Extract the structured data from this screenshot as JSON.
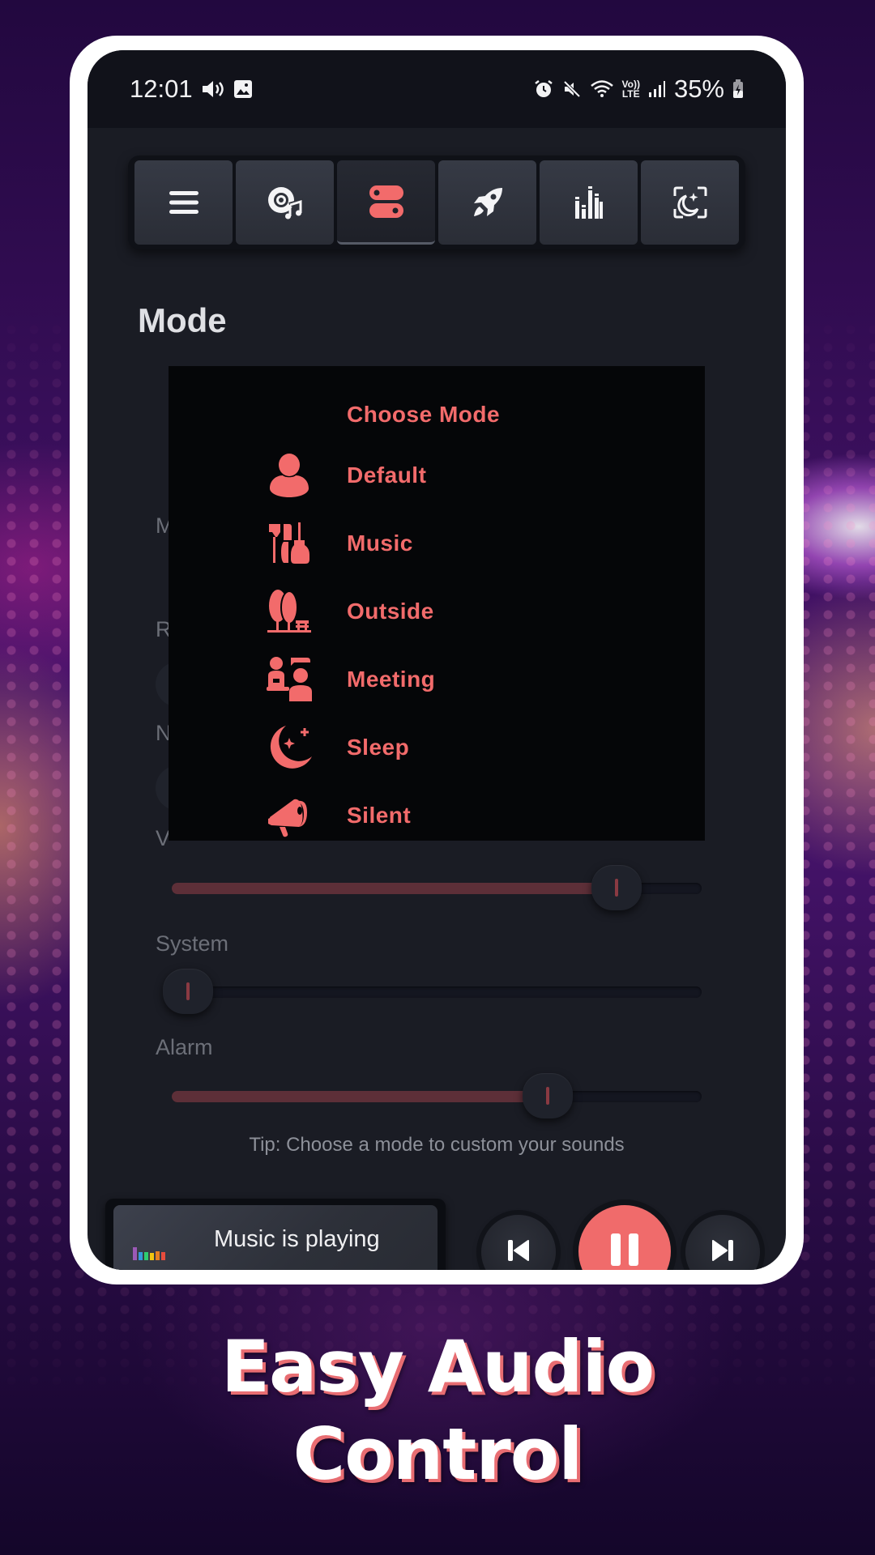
{
  "status_bar": {
    "time": "12:01",
    "left_icons": [
      "volume-icon",
      "image-icon"
    ],
    "right_icons": [
      "alarm-icon",
      "mute-icon",
      "wifi-icon",
      "volte-icon",
      "signal-icon"
    ],
    "volte_top": "Vo))",
    "volte_bottom": "LTE",
    "battery": "35%"
  },
  "toolbar": {
    "tabs": [
      {
        "name": "menu",
        "icon": "menu-icon",
        "active": false
      },
      {
        "name": "music-disc",
        "icon": "disc-music-icon",
        "active": false
      },
      {
        "name": "mode",
        "icon": "toggle-icon",
        "active": true
      },
      {
        "name": "boost",
        "icon": "rocket-icon",
        "active": false
      },
      {
        "name": "equalizer",
        "icon": "equalizer-icon",
        "active": false
      },
      {
        "name": "night",
        "icon": "moon-scan-icon",
        "active": false
      }
    ]
  },
  "page": {
    "title": "Mode",
    "hidden_labels": [
      "M",
      "R",
      "N",
      "V"
    ]
  },
  "sliders": [
    {
      "label": "",
      "value_pct": 84
    },
    {
      "label": "System",
      "value_pct": 3
    },
    {
      "label": "Alarm",
      "value_pct": 71
    }
  ],
  "tip": "Tip: Choose a mode to custom your sounds",
  "player": {
    "status": "Music is playing",
    "eq_colors": [
      "#9b59b6",
      "#3498db",
      "#2ecc71",
      "#f1c40f",
      "#e67e22",
      "#e74c3c"
    ],
    "prev_label": "previous",
    "play_state": "playing",
    "next_label": "next"
  },
  "mode_dialog": {
    "title": "Choose Mode",
    "items": [
      {
        "label": "Default",
        "icon": "person-icon"
      },
      {
        "label": "Music",
        "icon": "instruments-icon"
      },
      {
        "label": "Outside",
        "icon": "trees-icon"
      },
      {
        "label": "Meeting",
        "icon": "meeting-icon"
      },
      {
        "label": "Sleep",
        "icon": "moon-icon"
      },
      {
        "label": "Silent",
        "icon": "megaphone-icon"
      }
    ]
  },
  "colors": {
    "accent": "#f26b6b",
    "screen_bg": "#1a1c24",
    "dialog_bg": "#050608"
  },
  "headline": {
    "line1": "Easy Audio",
    "line2": "Control"
  }
}
